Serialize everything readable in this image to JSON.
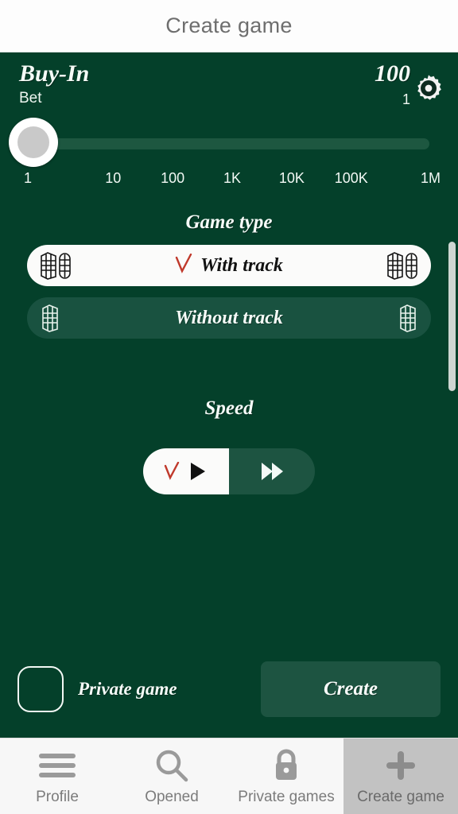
{
  "header": {
    "title": "Create game"
  },
  "buyin": {
    "title": "Buy-In",
    "subtitle": "Bet",
    "amount": "100",
    "multiplier": "1",
    "settings_icon": "gear-icon"
  },
  "slider": {
    "value": "1",
    "ticks": [
      "1",
      "10",
      "100",
      "1K",
      "10K",
      "100K",
      "1M"
    ]
  },
  "game_type": {
    "title": "Game type",
    "options": [
      {
        "label": "With track",
        "selected": true,
        "check": "✓"
      },
      {
        "label": "Without track",
        "selected": false,
        "check": ""
      }
    ]
  },
  "speed": {
    "title": "Speed",
    "options": [
      {
        "icon": "play-icon",
        "selected": true,
        "check": "✓"
      },
      {
        "icon": "fast-forward-icon",
        "selected": false,
        "check": ""
      }
    ]
  },
  "footer": {
    "private_label": "Private game",
    "private_checked": false,
    "create_label": "Create"
  },
  "navbar": {
    "items": [
      {
        "label": "Profile",
        "icon": "hamburger-icon",
        "active": false
      },
      {
        "label": "Opened",
        "icon": "search-icon",
        "active": false
      },
      {
        "label": "Private games",
        "icon": "lock-icon",
        "active": false
      },
      {
        "label": "Create game",
        "icon": "plus-icon",
        "active": true
      }
    ]
  },
  "colors": {
    "background": "#04402a",
    "panel": "#1d5441",
    "accent_check": "#c0392b",
    "nav_active": "#c2c2c2"
  }
}
